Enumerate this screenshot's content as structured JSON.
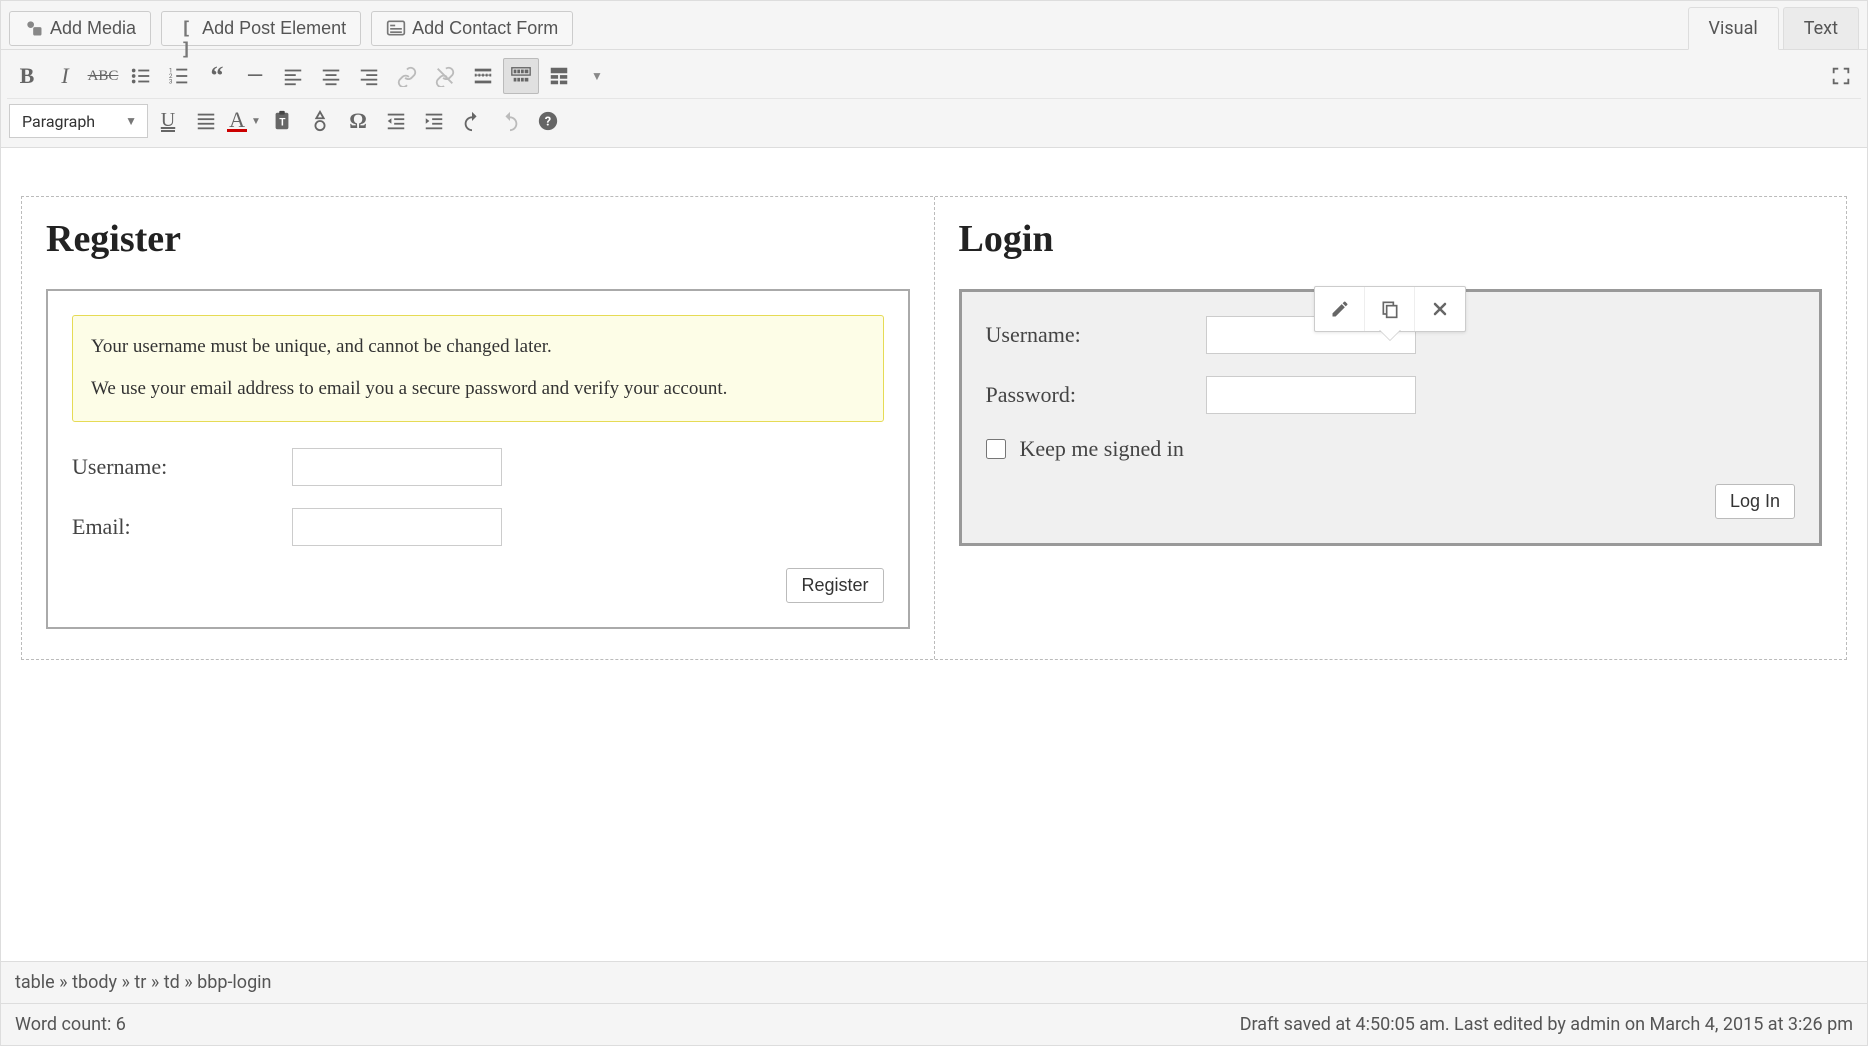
{
  "topbar": {
    "add_media": "Add Media",
    "add_post_element": "Add Post Element",
    "add_contact_form": "Add Contact Form"
  },
  "tabs": {
    "visual": "Visual",
    "text": "Text",
    "active": "visual"
  },
  "format_dropdown": "Paragraph",
  "content": {
    "register": {
      "heading": "Register",
      "notice_line1": "Your username must be unique, and cannot be changed later.",
      "notice_line2": "We use your email address to email you a secure password and verify your account.",
      "username_label": "Username:",
      "email_label": "Email:",
      "submit": "Register"
    },
    "login": {
      "heading": "Login",
      "username_label": "Username:",
      "password_label": "Password:",
      "keep_signed_in": "Keep me signed in",
      "submit": "Log In"
    }
  },
  "path_bar": "table » tbody » tr » td » bbp-login",
  "footer": {
    "word_count": "Word count: 6",
    "status": "Draft saved at 4:50:05 am. Last edited by admin on March 4, 2015 at 3:26 pm"
  }
}
